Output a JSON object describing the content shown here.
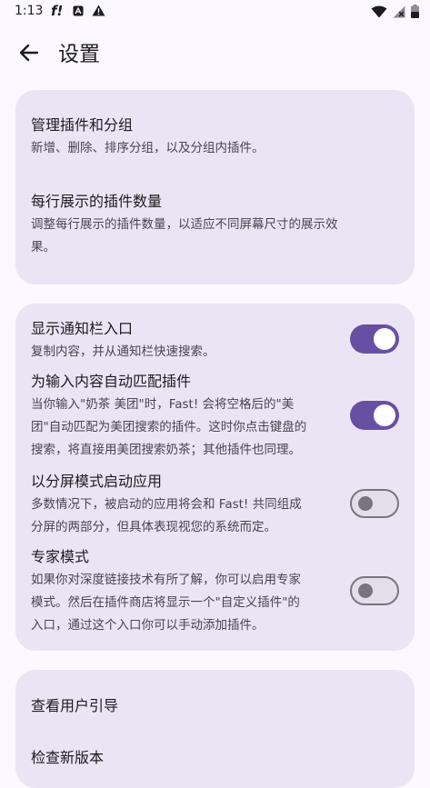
{
  "status_bar": {
    "time": "1:13",
    "f_icon_text": "f!",
    "icons": [
      "f-icon",
      "a-icon",
      "warning-icon",
      "wifi-icon",
      "signal-icon",
      "battery-icon"
    ]
  },
  "header": {
    "title": "设置"
  },
  "group1": {
    "items": [
      {
        "title": "管理插件和分组",
        "desc": "新增、删除、排序分组，以及分组内插件。"
      },
      {
        "title": "每行展示的插件数量",
        "desc_lines": [
          "调整每行展示的插件数量，以适应不同屏幕尺寸的展示效",
          "果。"
        ]
      }
    ]
  },
  "group2": {
    "items": [
      {
        "title": "显示通知栏入口",
        "desc_lines": [
          "复制内容，并从通知栏快速搜索。"
        ],
        "enabled": true
      },
      {
        "title": "为输入内容自动匹配插件",
        "desc_lines": [
          "当你输入\"奶茶 美团\"时，Fast! 会将空格后的\"美",
          "团\"自动匹配为美团搜索的插件。这时你点击键盘的",
          "搜索，将直接用美团搜索奶茶；其他插件也同理。"
        ],
        "enabled": true
      },
      {
        "title": "以分屏模式启动应用",
        "desc_lines": [
          "多数情况下，被启动的应用将会和 Fast! 共同组成",
          "分屏的两部分，但具体表现视您的系统而定。"
        ],
        "enabled": false
      },
      {
        "title": "专家模式",
        "desc_lines": [
          "如果你对深度链接技术有所了解，你可以启用专家",
          "模式。然后在插件商店将显示一个\"自定义插件\"的",
          "入口，通过这个入口你可以手动添加插件。"
        ],
        "enabled": false
      }
    ]
  },
  "group3": {
    "items": [
      {
        "title": "查看用户引导"
      },
      {
        "title": "检查新版本"
      }
    ]
  },
  "colors": {
    "background": "#FDF7FF",
    "card": "#EBE4F5",
    "accent": "#6750A4",
    "switch_off_track": "#E4DEEA",
    "outline": "#79747E"
  }
}
